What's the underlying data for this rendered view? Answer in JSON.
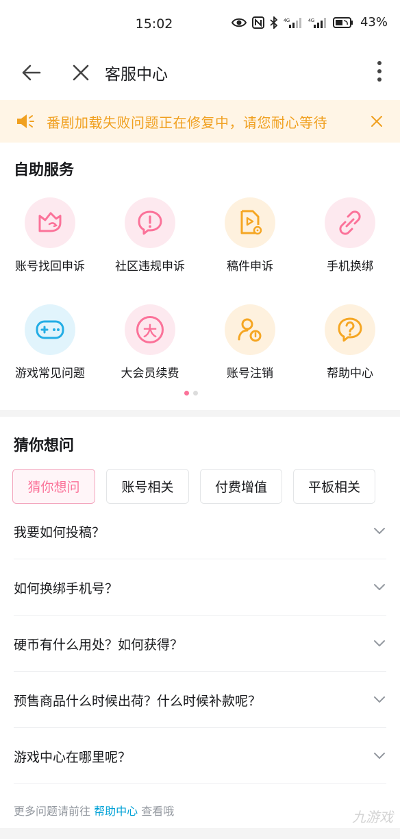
{
  "status_bar": {
    "time": "15:02",
    "network_1": "4G",
    "network_2": "4G",
    "battery": "43%"
  },
  "nav": {
    "title": "客服中心"
  },
  "notice": {
    "text": "番剧加载失败问题正在修复中，请您耐心等待"
  },
  "self_service": {
    "title": "自助服务",
    "items": [
      {
        "label": "账号找回申诉",
        "icon": "account-recover-icon",
        "color": "#fb7299",
        "bg": "#fde9ef"
      },
      {
        "label": "社区违规申诉",
        "icon": "community-violation-icon",
        "color": "#fb7299",
        "bg": "#fde9ef"
      },
      {
        "label": "稿件申诉",
        "icon": "video-file-icon",
        "color": "#f5a623",
        "bg": "#fef1de"
      },
      {
        "label": "手机换绑",
        "icon": "link-icon",
        "color": "#fb7299",
        "bg": "#fde9ef"
      },
      {
        "label": "游戏常见问题",
        "icon": "gamepad-icon",
        "color": "#23ade5",
        "bg": "#e1f4fc"
      },
      {
        "label": "大会员续费",
        "icon": "vip-icon",
        "color": "#fb7299",
        "bg": "#fde9ef",
        "glyph": "大"
      },
      {
        "label": "账号注销",
        "icon": "account-logout-icon",
        "color": "#f5a623",
        "bg": "#fef1de"
      },
      {
        "label": "帮助中心",
        "icon": "help-bubble-icon",
        "color": "#f5a623",
        "bg": "#fef1de"
      }
    ],
    "page_dots": {
      "active": "#fb7299",
      "inactive": "#dcdcdc"
    }
  },
  "faq": {
    "title": "猜你想问",
    "tabs": [
      {
        "label": "猜你想问"
      },
      {
        "label": "账号相关"
      },
      {
        "label": "付费增值"
      },
      {
        "label": "平板相关"
      }
    ],
    "questions": [
      "我要如何投稿？",
      "如何换绑手机号？",
      "硬币有什么用处？如何获得？",
      "预售商品什么时候出荷？什么时候补款呢？",
      "游戏中心在哪里呢？"
    ],
    "more": {
      "prefix": "更多问题请前往",
      "link": "帮助中心",
      "suffix": "查看哦"
    }
  },
  "watermark": "九游戏",
  "colors": {
    "accent_pink": "#fb7299",
    "accent_orange": "#f5a623",
    "accent_blue": "#23ade5",
    "link_blue": "#00a1d6",
    "notice_text": "#f0a020"
  }
}
